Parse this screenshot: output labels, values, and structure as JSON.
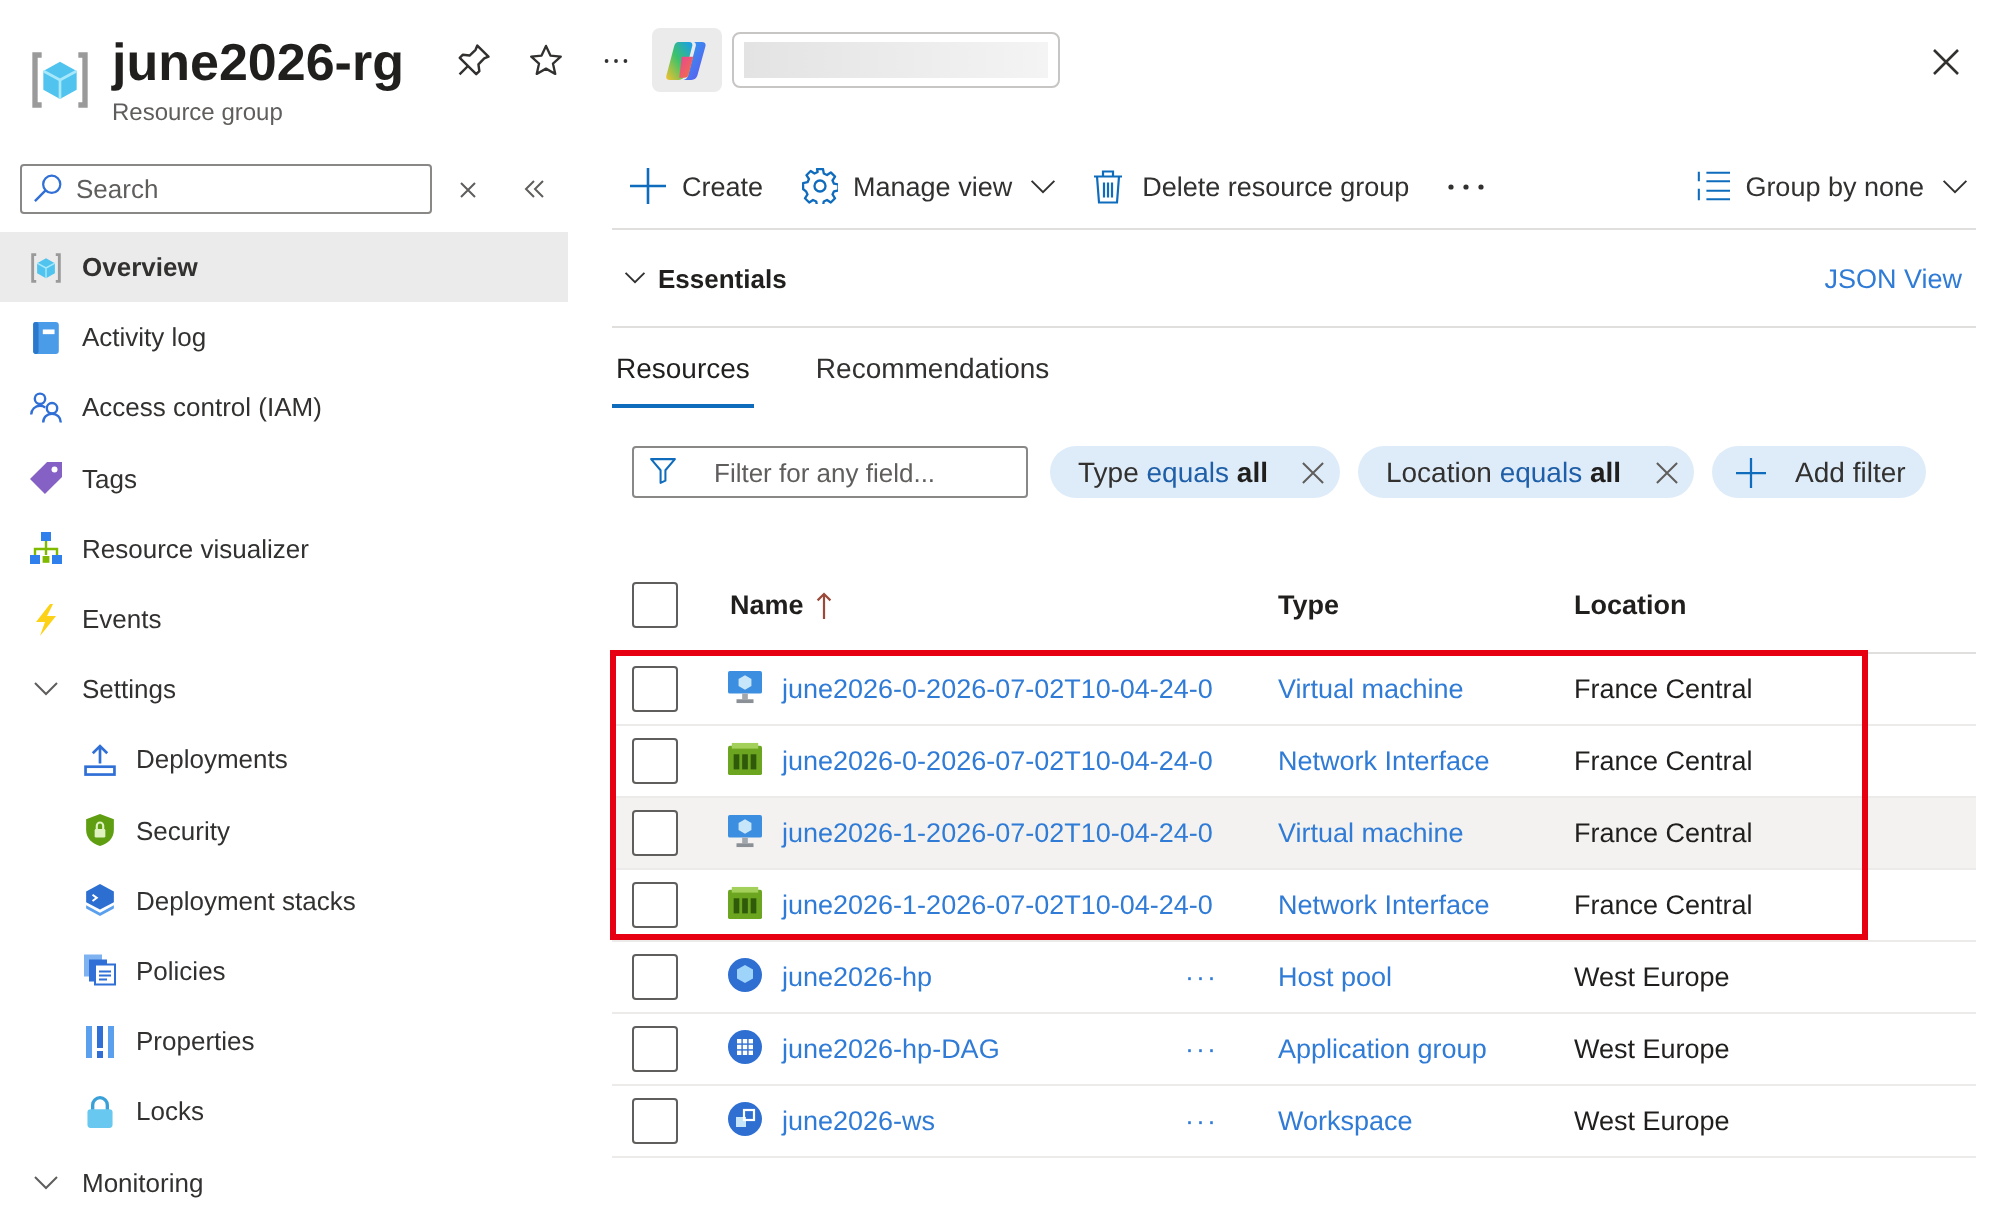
{
  "header": {
    "title": "june2026-rg",
    "subtitle": "Resource group"
  },
  "sidebar": {
    "search": {
      "placeholder": "Search"
    },
    "items": [
      {
        "kind": "item",
        "label": "Overview",
        "selected": true
      },
      {
        "kind": "item",
        "label": "Activity log",
        "selected": false
      },
      {
        "kind": "item",
        "label": "Access control (IAM)",
        "selected": false
      },
      {
        "kind": "item",
        "label": "Tags",
        "selected": false
      },
      {
        "kind": "item",
        "label": "Resource visualizer",
        "selected": false
      },
      {
        "kind": "item",
        "label": "Events",
        "selected": false
      },
      {
        "kind": "group",
        "label": "Settings",
        "expanded": true,
        "selected": false,
        "children": [
          {
            "kind": "item",
            "label": "Deployments",
            "selected": false
          },
          {
            "kind": "item",
            "label": "Security",
            "selected": false
          },
          {
            "kind": "item",
            "label": "Deployment stacks",
            "selected": false
          },
          {
            "kind": "item",
            "label": "Policies",
            "selected": false
          },
          {
            "kind": "item",
            "label": "Properties",
            "selected": false
          },
          {
            "kind": "item",
            "label": "Locks",
            "selected": false
          }
        ]
      },
      {
        "kind": "group",
        "label": "Monitoring",
        "expanded": true,
        "selected": false
      }
    ]
  },
  "toolbar": {
    "buttons": [
      {
        "label": "Create",
        "dropdown": false
      },
      {
        "label": "Manage view",
        "dropdown": true
      },
      {
        "label": "Delete resource group",
        "dropdown": false
      }
    ],
    "group_by": {
      "label": "Group by none",
      "dropdown": true
    }
  },
  "essentials": {
    "label": "Essentials",
    "link": "JSON View"
  },
  "tabs": [
    {
      "label": "Resources",
      "selected": true
    },
    {
      "label": "Recommendations",
      "selected": false
    }
  ],
  "filters": {
    "search": {
      "placeholder": "Filter for any field..."
    },
    "pills": [
      {
        "field": "Type",
        "operator": "equals",
        "value": "all"
      },
      {
        "field": "Location",
        "operator": "equals",
        "value": "all"
      }
    ],
    "add_label": "Add filter"
  },
  "table": {
    "select_all": {
      "checked": false
    },
    "columns": [
      {
        "label": "Name",
        "sorted": true
      },
      {
        "label": "Type",
        "sorted": false
      },
      {
        "label": "Location",
        "sorted": false
      }
    ],
    "rows": [
      {
        "kind": "virtual-machine",
        "name": "june2026-0-2026-07-02T10-04-24-0",
        "type": "Virtual machine",
        "location": "France Central",
        "checked": false,
        "hovered": false,
        "highlighted": true
      },
      {
        "kind": "network-interface",
        "name": "june2026-0-2026-07-02T10-04-24-0",
        "type": "Network Interface",
        "location": "France Central",
        "checked": false,
        "hovered": false,
        "highlighted": true
      },
      {
        "kind": "virtual-machine",
        "name": "june2026-1-2026-07-02T10-04-24-0",
        "type": "Virtual machine",
        "location": "France Central",
        "checked": false,
        "hovered": true,
        "highlighted": true
      },
      {
        "kind": "network-interface",
        "name": "june2026-1-2026-07-02T10-04-24-0",
        "type": "Network Interface",
        "location": "France Central",
        "checked": false,
        "hovered": false,
        "highlighted": true
      },
      {
        "kind": "host-pool",
        "name": "june2026-hp",
        "actions": "···",
        "type": "Host pool",
        "location": "West Europe",
        "checked": false,
        "hovered": false,
        "highlighted": false
      },
      {
        "kind": "application-group",
        "name": "june2026-hp-DAG",
        "actions": "···",
        "type": "Application group",
        "location": "West Europe",
        "checked": false,
        "hovered": false,
        "highlighted": false
      },
      {
        "kind": "workspace",
        "name": "june2026-ws",
        "actions": "···",
        "type": "Workspace",
        "location": "West Europe",
        "checked": false,
        "hovered": false,
        "highlighted": false
      }
    ]
  }
}
